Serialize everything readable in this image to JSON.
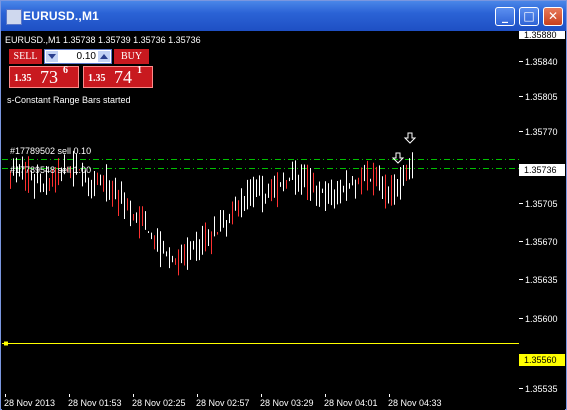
{
  "window": {
    "title": "EURUSD.,M1",
    "buttons": [
      "minimize-button",
      "maximize-button",
      "close-button"
    ]
  },
  "chart": {
    "info_line": "EURUSD.,M1  1.35738 1.35739 1.35736 1.35736",
    "trade_panel": {
      "sell_label": "SELL",
      "buy_label": "BUY",
      "lot_value": "0.10",
      "sell_price_prefix": "1.35",
      "sell_price_big": "73",
      "sell_price_sup": "6",
      "buy_price_prefix": "1.35",
      "buy_price_big": "74",
      "buy_price_sup": "1"
    },
    "status_message": "s-Constant Range Bars started",
    "orders": [
      {
        "label": "#17789502 sell 0.10",
        "price": 1.35743,
        "color": "#00c000"
      },
      {
        "label": "#17789548 sell 1.00",
        "price": 1.35734,
        "color": "#00c000"
      }
    ],
    "yellow_line_price": 1.3556,
    "price_axis": {
      "labels": [
        "1.35840",
        "1.35805",
        "1.35770",
        "1.35736",
        "1.35705",
        "1.35670",
        "1.35635",
        "1.35600",
        "1.35560",
        "1.35535"
      ],
      "top_label": "1.35880",
      "current_price": "1.35736",
      "yellow_price": "1.35560"
    },
    "time_axis": [
      "28 Nov 2013",
      "28 Nov 01:53",
      "28 Nov 02:25",
      "28 Nov 02:57",
      "28 Nov 03:29",
      "28 Nov 04:01",
      "28 Nov 04:33"
    ],
    "colors": {
      "background": "#000000",
      "bar": "#ffffff",
      "bear_bar": "#ff3030",
      "order_line": "#00c000",
      "yellow_line": "#ffff00"
    }
  }
}
